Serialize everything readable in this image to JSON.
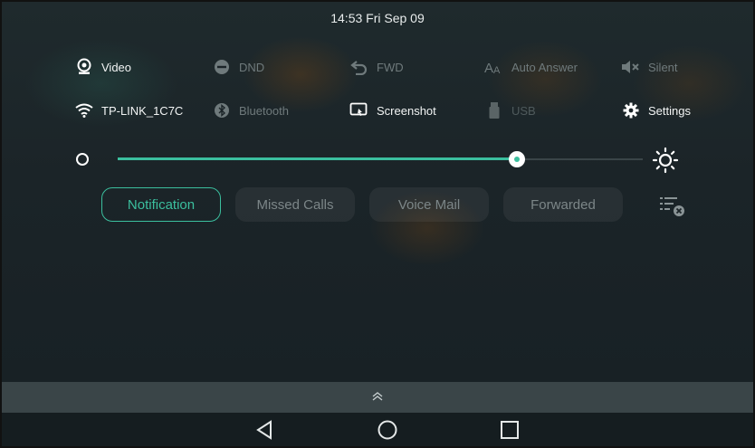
{
  "status": {
    "time": "14:53 Fri Sep 09"
  },
  "quick_settings": {
    "row1": [
      {
        "label": "Video",
        "icon": "video-icon",
        "state": "on"
      },
      {
        "label": "DND",
        "icon": "dnd-icon",
        "state": "off"
      },
      {
        "label": "FWD",
        "icon": "forward-icon",
        "state": "off"
      },
      {
        "label": "Auto Answer",
        "icon": "auto-answer-icon",
        "state": "off"
      },
      {
        "label": "Silent",
        "icon": "silent-icon",
        "state": "off"
      }
    ],
    "row2": [
      {
        "label": "TP-LINK_1C7C",
        "icon": "wifi-icon",
        "state": "on"
      },
      {
        "label": "Bluetooth",
        "icon": "bluetooth-icon",
        "state": "off"
      },
      {
        "label": "Screenshot",
        "icon": "screenshot-icon",
        "state": "on"
      },
      {
        "label": "USB",
        "icon": "usb-icon",
        "state": "off"
      },
      {
        "label": "Settings",
        "icon": "gear-icon",
        "state": "on"
      }
    ]
  },
  "brightness": {
    "level_fraction": 0.76
  },
  "tabs": [
    {
      "label": "Notification",
      "active": true
    },
    {
      "label": "Missed Calls",
      "active": false
    },
    {
      "label": "Voice Mail",
      "active": false
    },
    {
      "label": "Forwarded",
      "active": false
    }
  ],
  "colors": {
    "accent": "#3bbf9e",
    "panel": "#1b2428",
    "inactive_text": "#6f7a7c"
  }
}
